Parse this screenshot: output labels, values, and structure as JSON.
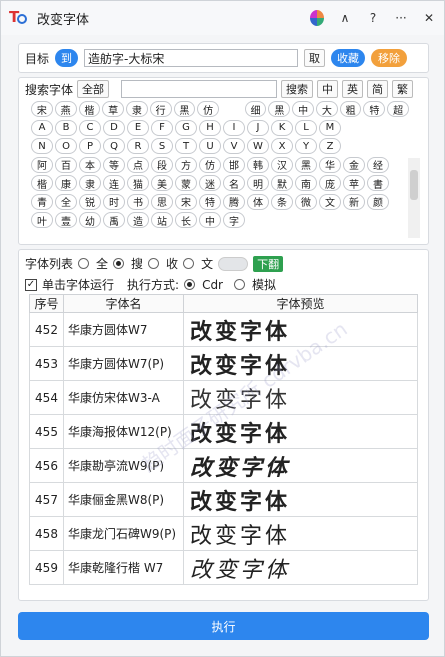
{
  "app": {
    "title": "改变字体"
  },
  "target": {
    "label": "目标",
    "to_button": "到",
    "value": "造舫字-大标宋",
    "take": "取",
    "collect": "收藏",
    "remove": "移除"
  },
  "search": {
    "label": "搜索字体",
    "all": "全部",
    "placeholder": "",
    "button": "搜索",
    "langs": [
      "中",
      "英",
      "简",
      "繁"
    ]
  },
  "chips": [
    [
      "宋",
      "燕",
      "楷",
      "草",
      "隶",
      "行",
      "黑",
      "仿",
      "",
      "细",
      "黑",
      "中",
      "大",
      "粗",
      "特",
      "超"
    ],
    [
      "A",
      "B",
      "C",
      "D",
      "E",
      "F",
      "G",
      "H",
      "I",
      "J",
      "K",
      "L",
      "M"
    ],
    [
      "N",
      "O",
      "P",
      "Q",
      "R",
      "S",
      "T",
      "U",
      "V",
      "W",
      "X",
      "Y",
      "Z"
    ],
    [
      "阿",
      "百",
      "本",
      "等",
      "点",
      "段",
      "方",
      "仿",
      "邯",
      "韩",
      "汉",
      "黑",
      "华",
      "金",
      "经"
    ],
    [
      "楷",
      "康",
      "隶",
      "连",
      "猫",
      "美",
      "蒙",
      "迷",
      "名",
      "明",
      "默",
      "南",
      "庞",
      "苹",
      "書"
    ],
    [
      "青",
      "全",
      "锐",
      "时",
      "书",
      "思",
      "宋",
      "特",
      "腾",
      "体",
      "条",
      "微",
      "文",
      "新",
      "颜"
    ],
    [
      "叶",
      "壹",
      "幼",
      "禹",
      "造",
      "站",
      "长",
      "中",
      "字"
    ]
  ],
  "filter": {
    "label": "字体列表",
    "options": [
      "全",
      "搜",
      "收",
      "文"
    ],
    "selected": "搜",
    "next": "下翻"
  },
  "run": {
    "single": "单击字体运行",
    "method_label": "执行方式:",
    "methods": [
      "Cdr",
      "模拟"
    ],
    "method_selected": "Cdr"
  },
  "table": {
    "headers": [
      "序号",
      "字体名",
      "字体预览"
    ],
    "preview": "改变字体",
    "rows": [
      {
        "no": "452",
        "name": "华康方圆体W7"
      },
      {
        "no": "453",
        "name": "华康方圆体W7(P)"
      },
      {
        "no": "454",
        "name": "华康仿宋体W3-A"
      },
      {
        "no": "455",
        "name": "华康海报体W12(P)"
      },
      {
        "no": "456",
        "name": "华康勘亭流W9(P)"
      },
      {
        "no": "457",
        "name": "华康俪金黑W8(P)"
      },
      {
        "no": "458",
        "name": "华康龙门石碑W9(P)"
      },
      {
        "no": "459",
        "name": "华康乾隆行楷 W7"
      }
    ]
  },
  "exec_button": "执行",
  "watermark": "趋时面子研究所 cdrvba.cn",
  "colors": {
    "accent": "#2d86ee",
    "orange": "#f2a03c",
    "green": "#2ea04f"
  }
}
